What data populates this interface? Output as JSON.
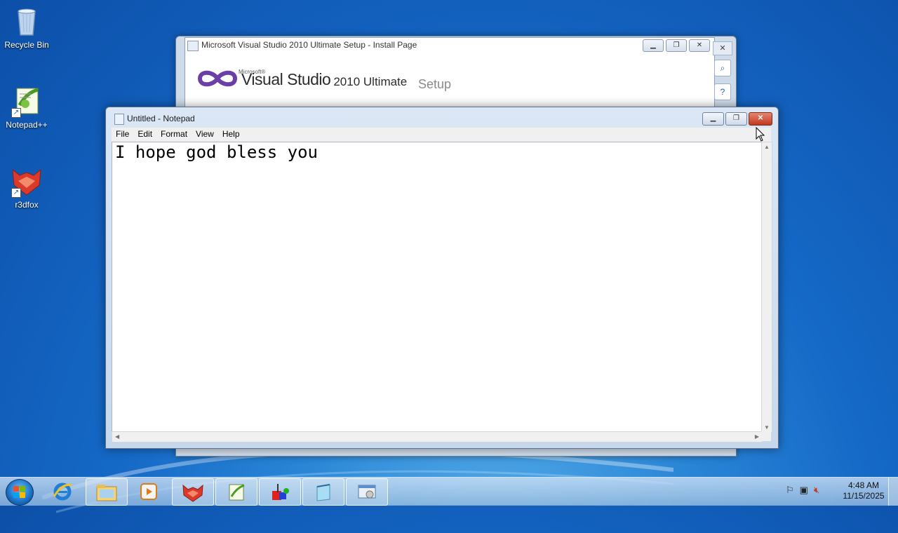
{
  "desktop": {
    "icons": [
      {
        "label": "Recycle Bin"
      },
      {
        "label": "Notepad++"
      },
      {
        "label": "r3dfox"
      }
    ]
  },
  "vs_window": {
    "title": "Microsoft Visual Studio 2010 Ultimate Setup - Install Page",
    "logo_microsoft": "Microsoft®",
    "logo_main": "Visual Studio",
    "logo_sub": "2010 Ultimate",
    "setup_label": "Setup"
  },
  "notepad": {
    "title": "Untitled - Notepad",
    "menu": [
      "File",
      "Edit",
      "Format",
      "View",
      "Help"
    ],
    "content": "I hope god bless you"
  },
  "taskbar": {
    "clock_time": "4:48 AM",
    "clock_date": "11/15/2025",
    "items": [
      "internet-explorer",
      "file-explorer",
      "media-player",
      "r3dfox",
      "notepad-plus-plus",
      "paint-app",
      "notepad",
      "setup-program"
    ]
  },
  "colors": {
    "desktop_blue": "#1569c7",
    "close_red": "#c0391e"
  }
}
